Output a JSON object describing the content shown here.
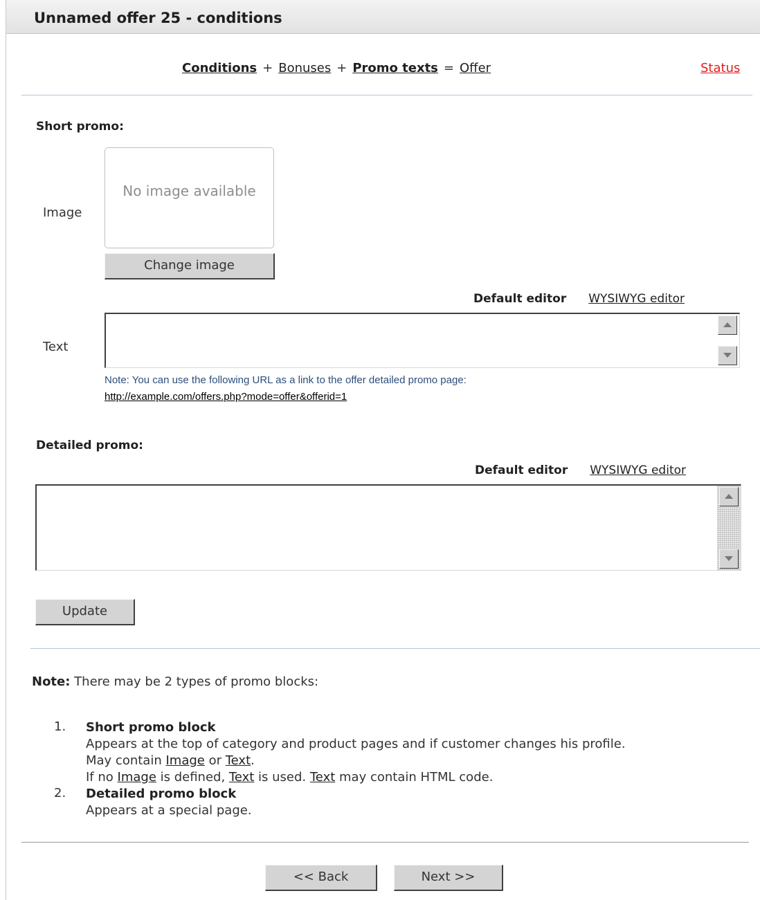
{
  "header": {
    "title": "Unnamed offer 25 - conditions"
  },
  "nav": {
    "conditions": "Conditions",
    "plus1": "+",
    "bonuses": "Bonuses",
    "plus2": "+",
    "promo_texts": "Promo texts",
    "equals": "=",
    "offer": "Offer",
    "status": "Status"
  },
  "short_promo": {
    "heading": "Short promo:",
    "image_label": "Image",
    "no_image": "No image available",
    "change_image_button": "Change image",
    "default_editor": "Default editor",
    "wysiwyg_editor": "WYSIWYG editor",
    "text_label": "Text",
    "text_value": "",
    "url_note": "Note: You can use the following URL as a link to the offer detailed promo page:",
    "url": "http://example.com/offers.php?mode=offer&offerid=1"
  },
  "detailed_promo": {
    "heading": "Detailed promo:",
    "default_editor": "Default editor",
    "wysiwyg_editor": "WYSIWYG editor",
    "text_value": ""
  },
  "update_button": "Update",
  "note": {
    "label": "Note:",
    "text": " There may be 2 types of promo blocks:",
    "items": [
      {
        "num": "1.",
        "title": "Short promo block",
        "line1": "Appears at the top of category and product pages and if customer changes his profile.",
        "line2_pre": "May contain ",
        "line2_link1": "Image",
        "line2_mid": " or ",
        "line2_link2": "Text",
        "line2_post": ".",
        "line3_pre": "If no ",
        "line3_link1": "Image",
        "line3_mid1": " is defined, ",
        "line3_link2": "Text",
        "line3_mid2": " is used. ",
        "line3_link3": "Text",
        "line3_post": " may contain HTML code."
      },
      {
        "num": "2.",
        "title": "Detailed promo block",
        "line1": "Appears at a special page."
      }
    ]
  },
  "back_button": "<< Back",
  "next_button": "Next >>"
}
